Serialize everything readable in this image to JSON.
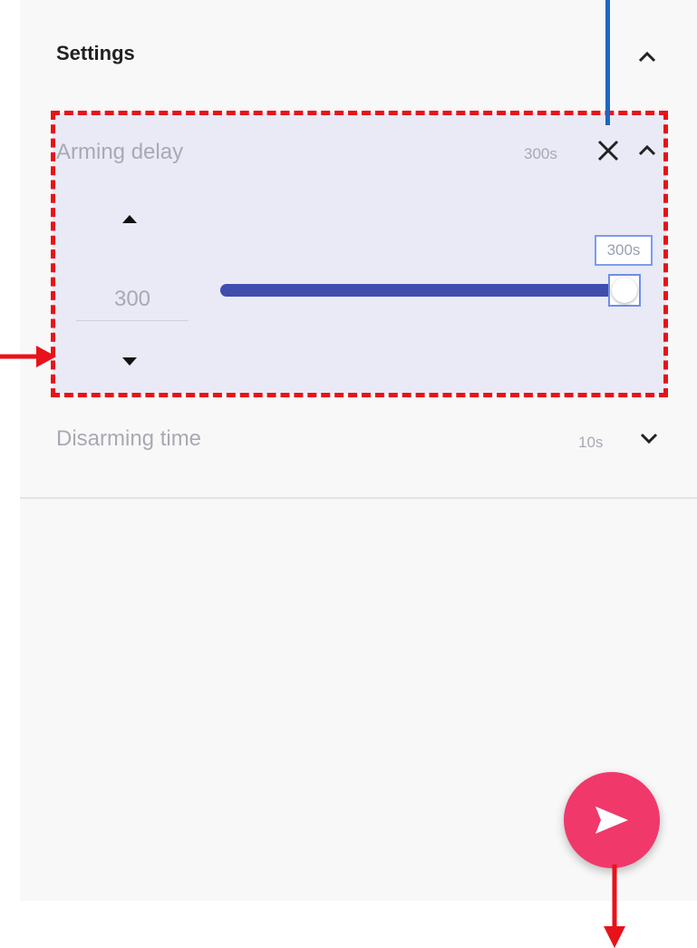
{
  "settings": {
    "title": "Settings"
  },
  "arming_delay": {
    "label": "Arming delay",
    "value_display": "300s",
    "stepper_value": "300",
    "slider_tooltip": "300s",
    "slider_fraction": 1.0
  },
  "disarming_time": {
    "label": "Disarming time",
    "value_display": "10s"
  },
  "colors": {
    "accent": "#3f4eae",
    "fab": "#f0386b",
    "annotation_red": "#e8121a",
    "annotation_blue": "#1d66c4",
    "expanded_bg": "#e9eaf6"
  },
  "icons": {
    "header_toggle": "chevron-up-icon",
    "close": "close-icon",
    "arming_toggle": "chevron-up-icon",
    "increment": "triangle-up-icon",
    "decrement": "triangle-down-icon",
    "disarm_toggle": "chevron-down-icon",
    "fab": "send-icon"
  }
}
